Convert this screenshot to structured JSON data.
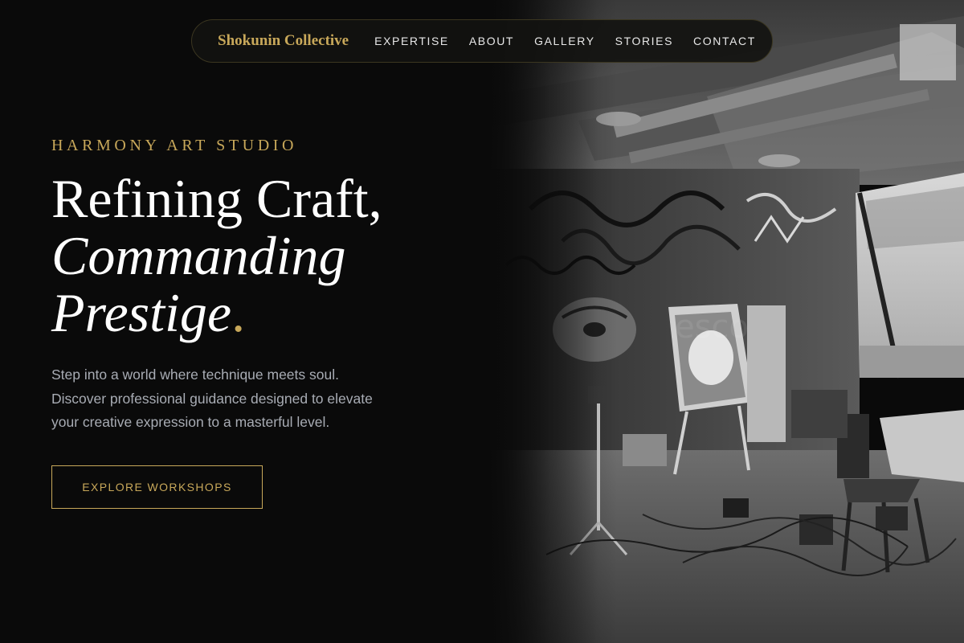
{
  "nav": {
    "brand": "Shokunin Collective",
    "links": [
      "EXPERTISE",
      "ABOUT",
      "GALLERY",
      "STORIES",
      "CONTACT"
    ]
  },
  "hero": {
    "eyebrow": "HARMONY ART STUDIO",
    "headline_line1": "Refining Craft,",
    "headline_line2": "Commanding",
    "headline_line3": "Prestige",
    "headline_period": ".",
    "lead_line1": "Step into a world where technique meets soul.",
    "lead_line2": "Discover professional guidance designed to elevate",
    "lead_line3": "your creative expression to a masterful level.",
    "cta_label": "EXPLORE WORKSHOPS"
  },
  "image": {
    "subject": "black-and-white photo of an art studio with graffiti walls, easel with painting, chair and lighting equipment"
  },
  "colors": {
    "background": "#0a0a0a",
    "accent_gold": "#c8a85a",
    "body_text": "#a8acb4",
    "heading_text": "#ffffff"
  }
}
